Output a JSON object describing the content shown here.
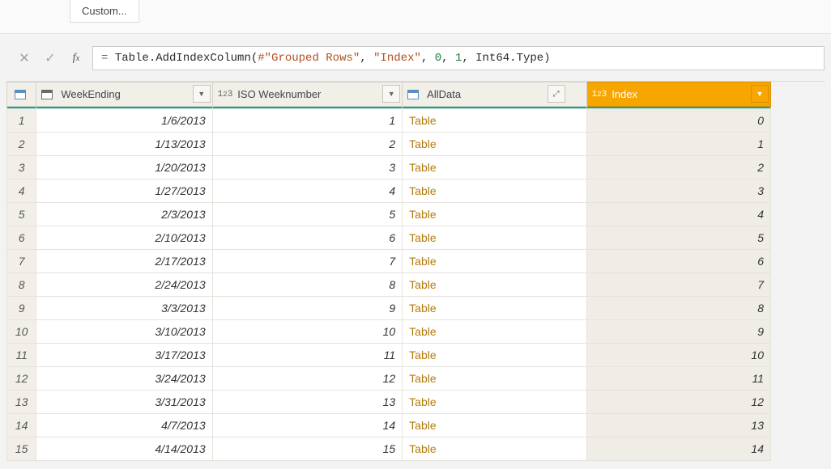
{
  "ribbon": {
    "custom_label": "Custom..."
  },
  "formula": {
    "eq": "= ",
    "fn": "Table.AddIndexColumn",
    "open": "(",
    "ref": "#\"Grouped Rows\"",
    "c1": ", ",
    "str": "\"Index\"",
    "c2": ", ",
    "n0": "0",
    "c3": ", ",
    "n1": "1",
    "c4": ", ",
    "type": "Int64.Type",
    "close": ")"
  },
  "columns": {
    "weekending": "WeekEnding",
    "iso": "ISO Weeknumber",
    "alldata": "AllData",
    "index": "Index"
  },
  "rows": [
    {
      "n": "1",
      "date": "1/6/2013",
      "iso": "1",
      "all": "Table",
      "idx": "0"
    },
    {
      "n": "2",
      "date": "1/13/2013",
      "iso": "2",
      "all": "Table",
      "idx": "1"
    },
    {
      "n": "3",
      "date": "1/20/2013",
      "iso": "3",
      "all": "Table",
      "idx": "2"
    },
    {
      "n": "4",
      "date": "1/27/2013",
      "iso": "4",
      "all": "Table",
      "idx": "3"
    },
    {
      "n": "5",
      "date": "2/3/2013",
      "iso": "5",
      "all": "Table",
      "idx": "4"
    },
    {
      "n": "6",
      "date": "2/10/2013",
      "iso": "6",
      "all": "Table",
      "idx": "5"
    },
    {
      "n": "7",
      "date": "2/17/2013",
      "iso": "7",
      "all": "Table",
      "idx": "6"
    },
    {
      "n": "8",
      "date": "2/24/2013",
      "iso": "8",
      "all": "Table",
      "idx": "7"
    },
    {
      "n": "9",
      "date": "3/3/2013",
      "iso": "9",
      "all": "Table",
      "idx": "8"
    },
    {
      "n": "10",
      "date": "3/10/2013",
      "iso": "10",
      "all": "Table",
      "idx": "9"
    },
    {
      "n": "11",
      "date": "3/17/2013",
      "iso": "11",
      "all": "Table",
      "idx": "10"
    },
    {
      "n": "12",
      "date": "3/24/2013",
      "iso": "12",
      "all": "Table",
      "idx": "11"
    },
    {
      "n": "13",
      "date": "3/31/2013",
      "iso": "13",
      "all": "Table",
      "idx": "12"
    },
    {
      "n": "14",
      "date": "4/7/2013",
      "iso": "14",
      "all": "Table",
      "idx": "13"
    },
    {
      "n": "15",
      "date": "4/14/2013",
      "iso": "15",
      "all": "Table",
      "idx": "14"
    }
  ]
}
